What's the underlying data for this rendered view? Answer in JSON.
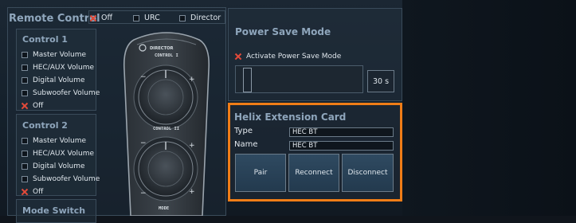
{
  "remote_control": {
    "title": "Remote Control",
    "mode_options": [
      {
        "label": "Off",
        "checked": true
      },
      {
        "label": "URC",
        "checked": false
      },
      {
        "label": "Director",
        "checked": false
      }
    ],
    "groups": [
      {
        "title": "Control 1",
        "options": [
          {
            "label": "Master Volume",
            "checked": false
          },
          {
            "label": "HEC/AUX Volume",
            "checked": false
          },
          {
            "label": "Digital Volume",
            "checked": false
          },
          {
            "label": "Subwoofer Volume",
            "checked": false
          },
          {
            "label": "Off",
            "checked": true
          }
        ]
      },
      {
        "title": "Control 2",
        "options": [
          {
            "label": "Master Volume",
            "checked": false
          },
          {
            "label": "HEC/AUX Volume",
            "checked": false
          },
          {
            "label": "Digital Volume",
            "checked": false
          },
          {
            "label": "Subwoofer Volume",
            "checked": false
          },
          {
            "label": "Off",
            "checked": true
          }
        ]
      },
      {
        "title": "Mode Switch",
        "options": []
      }
    ],
    "remote_graphic": {
      "brand": "DIRECTOR",
      "label_control_1": "CONTROL I",
      "label_control_2": "CONTROL II",
      "label_mode": "MODE"
    }
  },
  "power_save": {
    "title": "Power Save Mode",
    "activate_label": "Activate Power Save Mode",
    "activate_checked": true,
    "slider_fraction": 0.05,
    "value_display": "30 s"
  },
  "helix_card": {
    "title": "Helix Extension Card",
    "type_label": "Type",
    "type_value": "HEC BT",
    "name_label": "Name",
    "name_value": "HEC BT",
    "buttons": {
      "pair": "Pair",
      "reconnect": "Reconnect",
      "disconnect": "Disconnect"
    },
    "highlight_color": "#f07d17"
  },
  "colors": {
    "accent": "#f07d17",
    "check_x": "#e34a3a",
    "slider_fill": "#ff7a1a"
  }
}
